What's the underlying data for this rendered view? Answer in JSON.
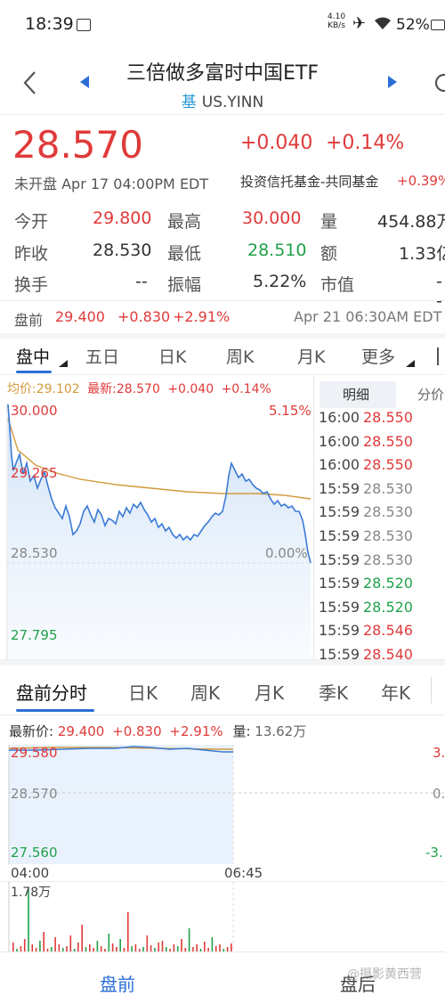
{
  "status_bar": {
    "time": "18:39",
    "net_speed_top": "4.10",
    "net_speed_bottom": "KB/s",
    "battery": "52%"
  },
  "header": {
    "title": "三倍做多富时中国ETF",
    "badge": "基",
    "symbol": "US.YINN"
  },
  "quote": {
    "price": "28.570",
    "change": "+0.040",
    "change_pct": "+0.14%",
    "market_status": "未开盘 Apr 17 04:00PM EDT",
    "category": "投资信托基金-共同基金",
    "category_change": "+0.39%",
    "stats": {
      "open_label": "今开",
      "open": "29.800",
      "high_label": "最高",
      "high": "30.000",
      "volume_label": "量",
      "volume": "454.88万",
      "prev_close_label": "昨收",
      "prev_close": "28.530",
      "low_label": "最低",
      "low": "28.510",
      "amount_label": "额",
      "amount": "1.33亿",
      "turnover_label": "换手",
      "turnover": "--",
      "amplitude_label": "振幅",
      "amplitude": "5.22%",
      "mkt_cap_label": "市值",
      "mkt_cap": "--"
    },
    "premarket_label": "盘前",
    "premarket_price": "29.400",
    "premarket_change": "+0.830",
    "premarket_pct": "+2.91%",
    "premarket_time": "Apr 21 06:30AM EDT"
  },
  "chart_tabs": [
    "盘中",
    "五日",
    "日K",
    "周K",
    "月K",
    "更多"
  ],
  "intraday": {
    "avg_label": "均价:29.102",
    "latest_label": "最新:28.570",
    "change": "+0.040",
    "change_pct": "+0.14%",
    "y_top": "30.000",
    "y_top_pct": "5.15%",
    "y_upper": "29.265",
    "y_mid": "28.530",
    "y_mid_pct": "0.00%",
    "y_bottom": "27.795"
  },
  "ticks_tabs": [
    "明细",
    "分价"
  ],
  "ticks": [
    {
      "time": "16:00",
      "price": "28.550",
      "dir": "up"
    },
    {
      "time": "16:00",
      "price": "28.550",
      "dir": "up"
    },
    {
      "time": "16:00",
      "price": "28.550",
      "dir": "up"
    },
    {
      "time": "15:59",
      "price": "28.530",
      "dir": "flat"
    },
    {
      "time": "15:59",
      "price": "28.530",
      "dir": "flat"
    },
    {
      "time": "15:59",
      "price": "28.530",
      "dir": "flat"
    },
    {
      "time": "15:59",
      "price": "28.530",
      "dir": "flat"
    },
    {
      "time": "15:59",
      "price": "28.520",
      "dir": "down"
    },
    {
      "time": "15:59",
      "price": "28.520",
      "dir": "down"
    },
    {
      "time": "15:59",
      "price": "28.546",
      "dir": "up"
    },
    {
      "time": "15:59",
      "price": "28.540",
      "dir": "up"
    }
  ],
  "pre_tabs": [
    "盘前分时",
    "日K",
    "周K",
    "月K",
    "季K",
    "年K"
  ],
  "pre_chart": {
    "latest_label": "最新价:",
    "latest": "29.400",
    "change": "+0.830",
    "change_pct": "+2.91%",
    "vol_label": "量:",
    "vol": "13.62万",
    "y_top": "29.580",
    "y_top_pct": "3.",
    "y_mid": "28.570",
    "y_mid_pct": "0.",
    "y_bottom": "27.560",
    "y_bottom_pct": "-3.",
    "x_start": "04:00",
    "x_mid": "06:45",
    "vol_max": "1.78万"
  },
  "bottom_nav": {
    "left": "盘前",
    "right": "盘后"
  },
  "watermark": "@摄影黄西营",
  "colors": {
    "up": "#e03a3a",
    "down": "#1fa14a",
    "line": "#3b7bd6",
    "avg": "#d39a3c",
    "accent": "#2b6fd6"
  }
}
